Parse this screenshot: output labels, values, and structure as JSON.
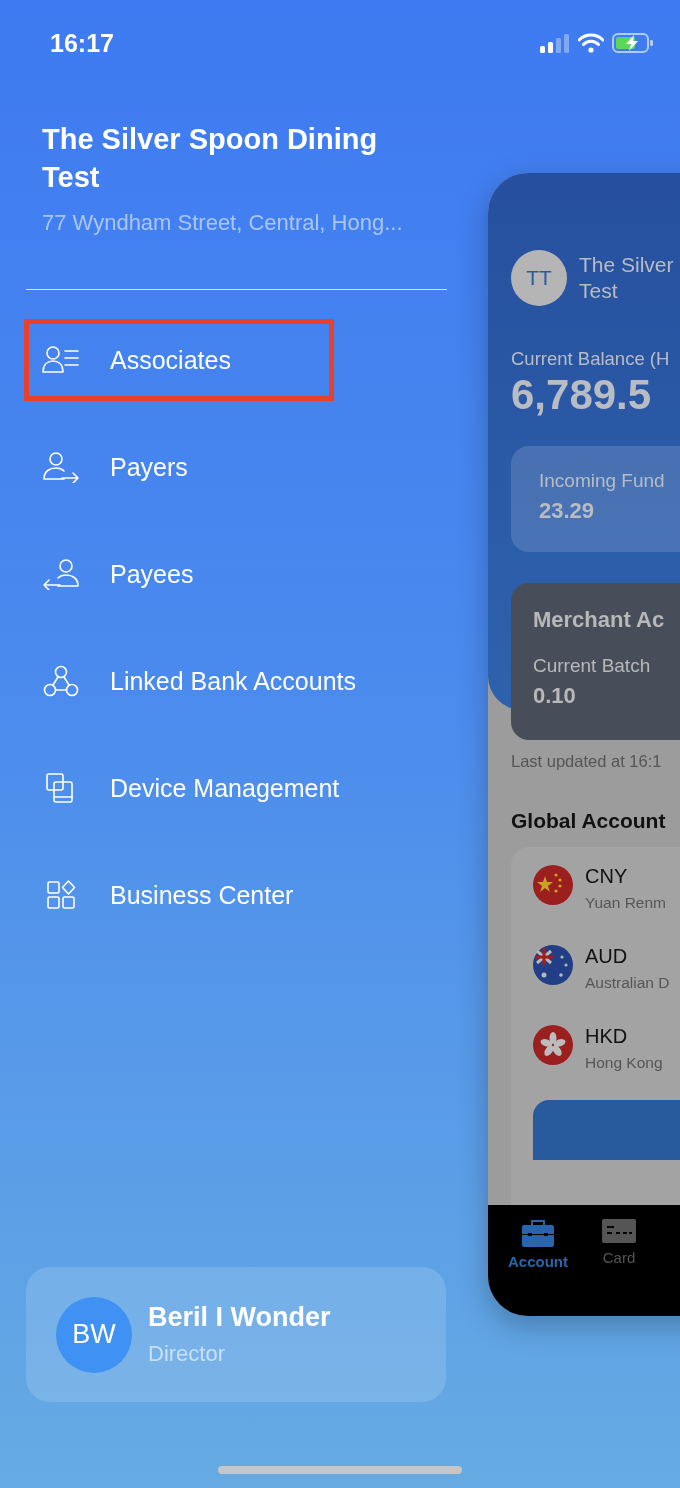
{
  "status_bar": {
    "time": "16:17"
  },
  "business": {
    "name": "The Silver Spoon Dining Test",
    "address": "77 Wyndham Street, Central, Hong..."
  },
  "menu": [
    {
      "kind": "associates",
      "label": "Associates",
      "highlighted": true
    },
    {
      "kind": "payers",
      "label": "Payers",
      "highlighted": false
    },
    {
      "kind": "payees",
      "label": "Payees",
      "highlighted": false
    },
    {
      "kind": "linked",
      "label": "Linked Bank Accounts",
      "highlighted": false
    },
    {
      "kind": "devices",
      "label": "Device Management",
      "highlighted": false
    },
    {
      "kind": "business",
      "label": "Business Center",
      "highlighted": false
    }
  ],
  "user": {
    "initials": "BW",
    "name": "Beril I Wonder",
    "role": "Director"
  },
  "preview": {
    "initials": "TT",
    "name_lines": [
      "The Silver",
      "Test"
    ],
    "balance_label": "Current Balance (H",
    "balance": "6,789.5",
    "incoming_label": "Incoming Fund",
    "incoming": "23.29",
    "merchant_title": "Merchant Ac",
    "batch_label": "Current Batch",
    "batch": "0.10",
    "updated": "Last updated at 16:1",
    "section_title": "Global Account",
    "currencies": [
      {
        "kind": "cny",
        "code": "CNY",
        "name": "Yuan Renm"
      },
      {
        "kind": "aud",
        "code": "AUD",
        "name": "Australian D"
      },
      {
        "kind": "hkd",
        "code": "HKD",
        "name": "Hong Kong"
      }
    ],
    "tabs": [
      {
        "kind": "account",
        "label": "Account",
        "selected": true
      },
      {
        "kind": "card",
        "label": "Card",
        "selected": false
      }
    ]
  }
}
